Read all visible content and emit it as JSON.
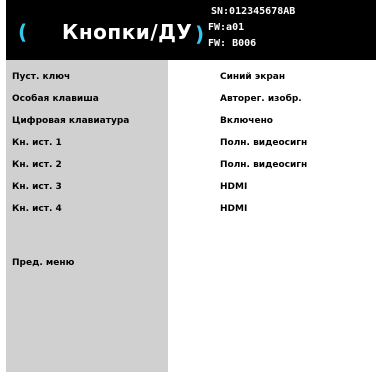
{
  "header": {
    "title": "Кнопки/ДУ",
    "serial": "SN:012345678AB",
    "fw_a": "FW:a01",
    "fw_b": "FW: B006"
  },
  "menu": {
    "rows": [
      {
        "label": "Пуст. ключ",
        "value": "Синий экран"
      },
      {
        "label": "Особая клавиша",
        "value": "Авторег. изобр."
      },
      {
        "label": "Цифровая клавиатура",
        "value": "Включено"
      },
      {
        "label": "Кн. ист. 1",
        "value": "Полн. видеосигн"
      },
      {
        "label": "Кн. ист. 2",
        "value": "Полн. видеосигн"
      },
      {
        "label": "Кн. ист. 3",
        "value": "HDMI"
      },
      {
        "label": "Кн. ист. 4",
        "value": "HDMI"
      }
    ],
    "prev_menu": "Пред. меню"
  },
  "colors": {
    "accent": "#34c8f0",
    "header_bg": "#000000",
    "label_panel_bg": "#d0d0d0"
  }
}
